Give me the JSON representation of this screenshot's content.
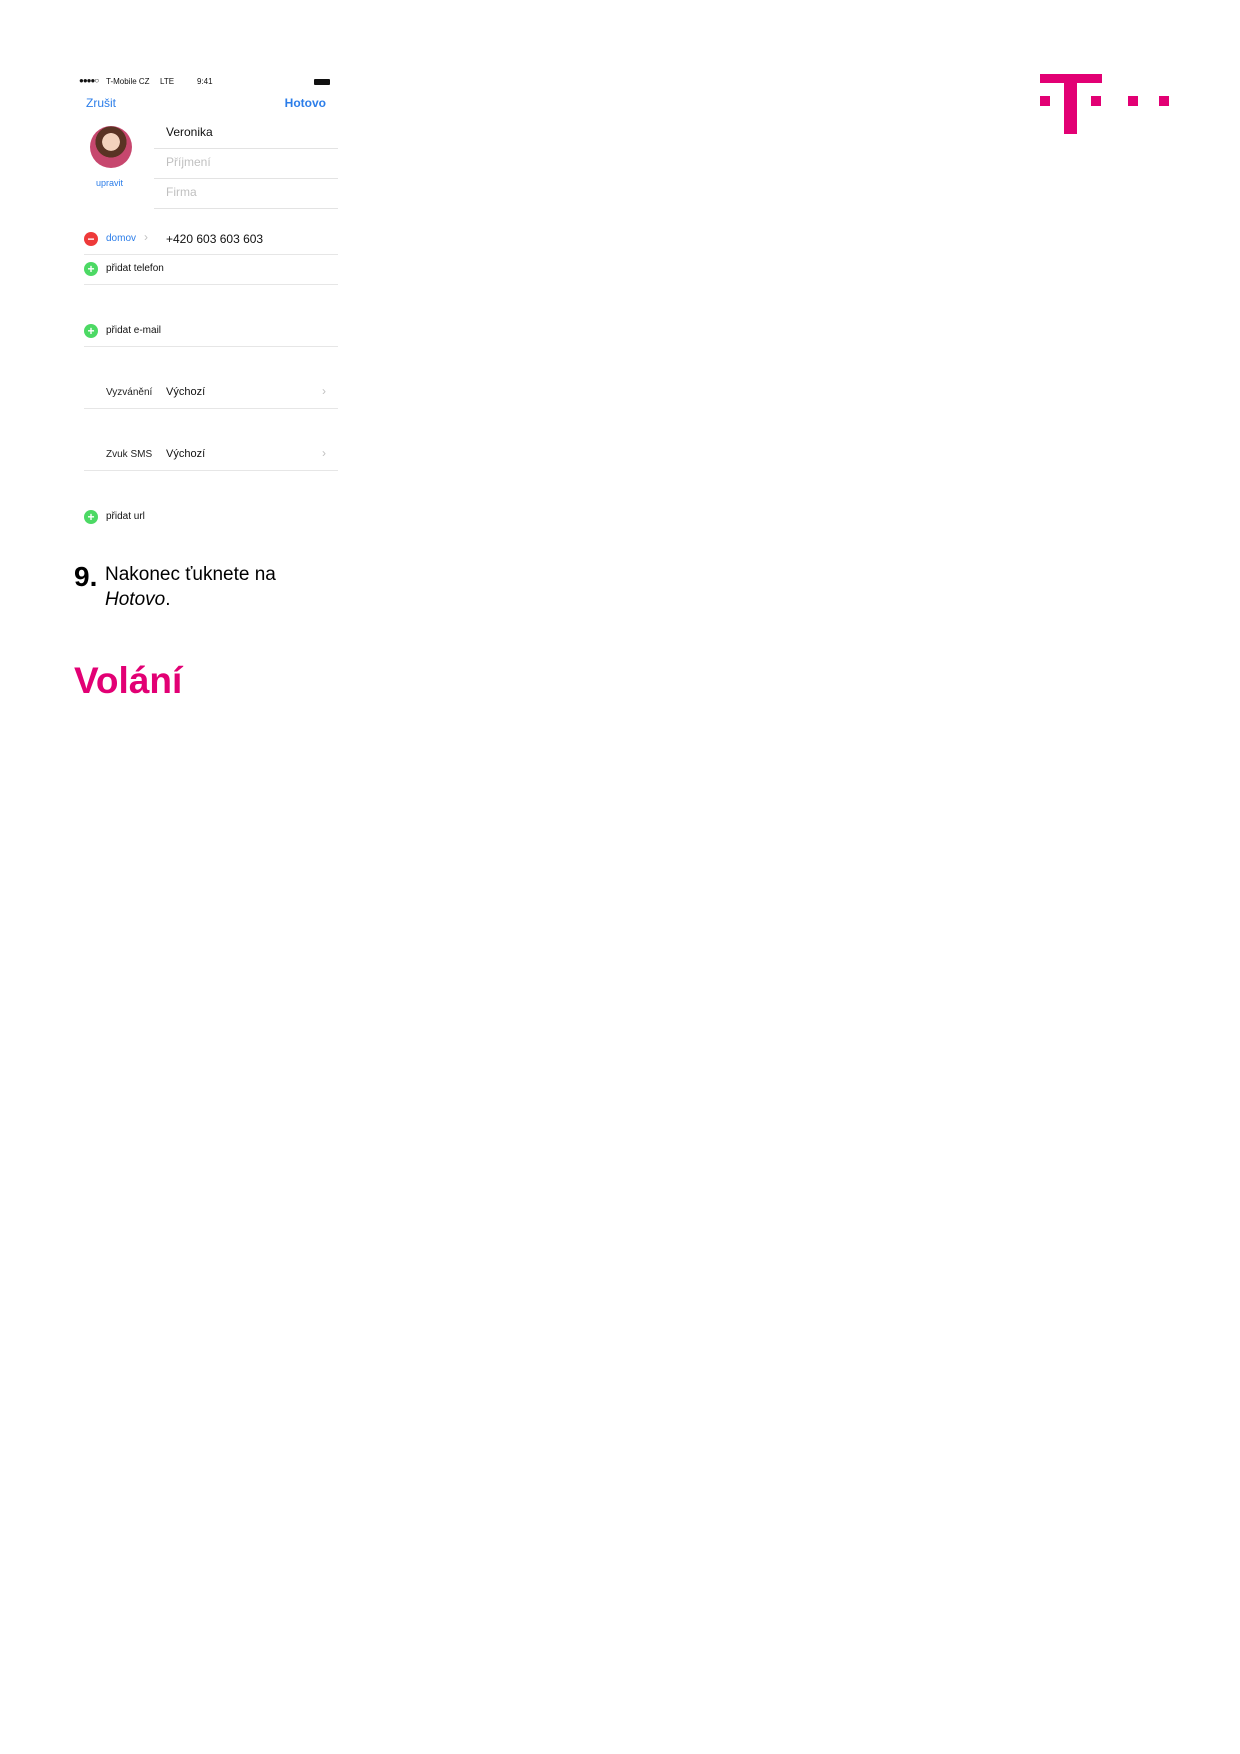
{
  "brand": {
    "logo_color": "#e20074",
    "heading_color": "#e20074"
  },
  "phone_screenshot": {
    "status_bar": {
      "signal": "●●●●○",
      "carrier": "T-Mobile CZ",
      "network": "LTE",
      "time": "9:41"
    },
    "nav": {
      "cancel": "Zrušit",
      "done": "Hotovo"
    },
    "avatar_edit": "upravit",
    "name_fields": [
      {
        "value": "Veronika",
        "placeholder": false
      },
      {
        "value": "Příjmení",
        "placeholder": true
      },
      {
        "value": "Firma",
        "placeholder": true
      }
    ],
    "phone_row": {
      "label": "domov",
      "number": "+420 603 603 603"
    },
    "add_phone": "přidat telefon",
    "add_email": "přidat e-mail",
    "ringtone": {
      "label": "Vyzvánění",
      "value": "Výchozí"
    },
    "sms_sound": {
      "label": "Zvuk SMS",
      "value": "Výchozí"
    },
    "add_url": "přidat url"
  },
  "step": {
    "number": "9.",
    "text": "Nakonec ťuknete na",
    "emphasis": "Hotovo",
    "suffix": "."
  },
  "section_heading": "Volání"
}
